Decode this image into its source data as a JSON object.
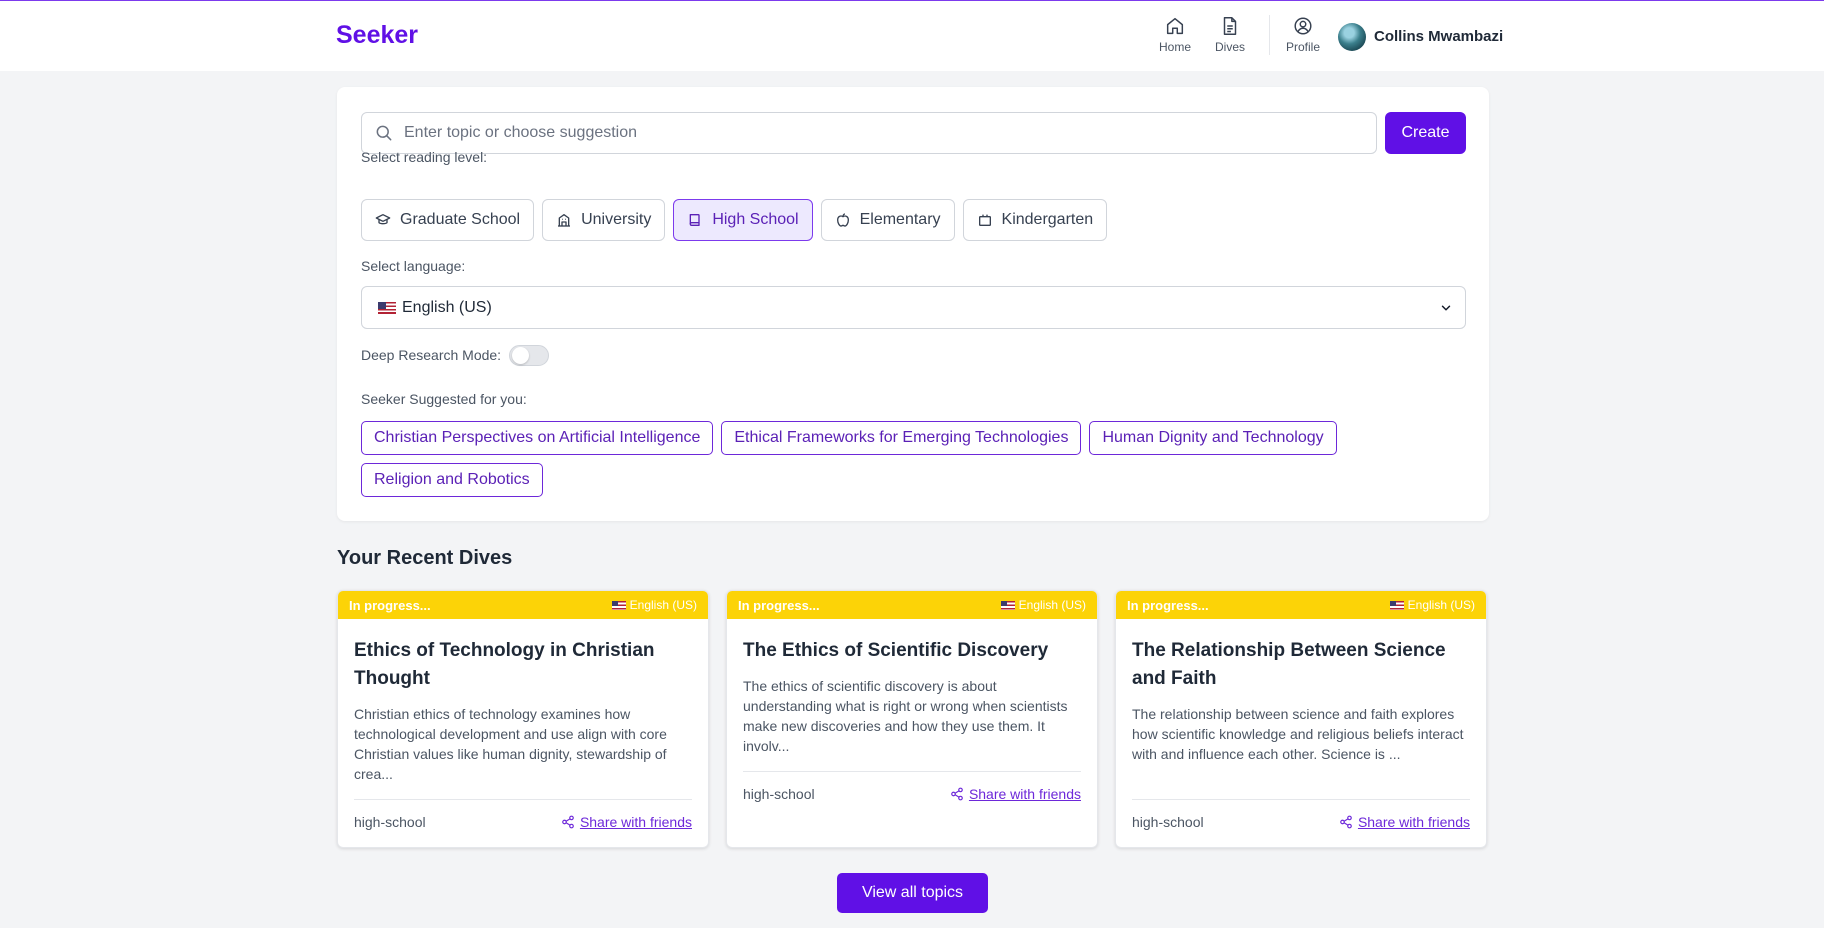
{
  "app": {
    "brand": "Seeker"
  },
  "nav": {
    "items": [
      {
        "label": "Home",
        "icon": "home-icon"
      },
      {
        "label": "Dives",
        "icon": "document-icon"
      },
      {
        "label": "Profile",
        "icon": "user-circle-icon"
      }
    ],
    "user_name": "Collins Mwambazi"
  },
  "create_form": {
    "search_placeholder": "Enter topic or choose suggestion",
    "search_value": "",
    "create_label": "Create",
    "reading_level_label": "Select reading level:",
    "reading_levels": [
      {
        "label": "Graduate School",
        "icon": "graduation-cap-icon",
        "selected": false
      },
      {
        "label": "University",
        "icon": "building-icon",
        "selected": false
      },
      {
        "label": "High School",
        "icon": "book-icon",
        "selected": true
      },
      {
        "label": "Elementary",
        "icon": "apple-icon",
        "selected": false
      },
      {
        "label": "Kindergarten",
        "icon": "cube-icon",
        "selected": false
      }
    ],
    "language_label": "Select language:",
    "language_value": "English (US)",
    "deep_research_label": "Deep Research Mode:",
    "deep_research_on": false,
    "suggested_label": "Seeker Suggested for you:",
    "suggestions": [
      "Christian Perspectives on Artificial Intelligence",
      "Ethical Frameworks for Emerging Technologies",
      "Human Dignity and Technology",
      "Religion and Robotics"
    ]
  },
  "recent": {
    "title": "Your Recent Dives",
    "dives": [
      {
        "status": "In progress...",
        "language": "English (US)",
        "title": "Ethics of Technology in Christian Thought",
        "summary": "Christian ethics of technology examines how technological development and use align with core Christian values like human dignity, stewardship of crea...",
        "level": "high-school",
        "share_label": "Share with friends"
      },
      {
        "status": "In progress...",
        "language": "English (US)",
        "title": "The Ethics of Scientific Discovery",
        "summary": "The ethics of scientific discovery is about understanding what is right or wrong when scientists make new discoveries and how they use them. It involv...",
        "level": "high-school",
        "share_label": "Share with friends"
      },
      {
        "status": "In progress...",
        "language": "English (US)",
        "title": "The Relationship Between Science and Faith",
        "summary": "The relationship between science and faith explores how scientific knowledge and religious beliefs interact with and influence each other. Science is ...",
        "level": "high-school",
        "share_label": "Share with friends"
      }
    ],
    "view_all_label": "View all topics"
  },
  "colors": {
    "brand": "#6010e6",
    "status_bar": "#fcd307",
    "background": "#f3f4f6"
  }
}
